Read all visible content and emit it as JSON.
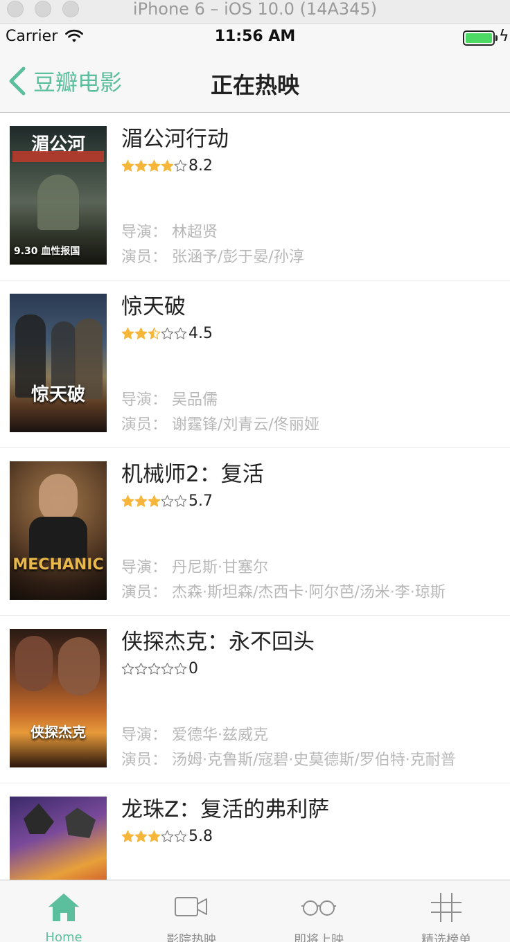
{
  "simulator": {
    "title": "iPhone 6 – iOS 10.0 (14A345)"
  },
  "status_bar": {
    "carrier": "Carrier",
    "time": "11:56 AM"
  },
  "navbar": {
    "back_label": "豆瓣电影",
    "title": "正在热映"
  },
  "colors": {
    "accent": "#5bbf9e",
    "star": "#f5b63a",
    "muted": "#b8b8b8"
  },
  "movies": [
    {
      "title": "湄公河行动",
      "stars": 4,
      "score": "8.2",
      "director": "导演：  林超贤",
      "actors": "演员：  张涵予/彭于晏/孙淳",
      "poster_text": "9.30 血性报国"
    },
    {
      "title": "惊天破",
      "stars": 2.5,
      "score": "4.5",
      "director": "导演：  吴品儒",
      "actors": "演员：  谢霆锋/刘青云/佟丽娅",
      "poster_text": "惊天破"
    },
    {
      "title": "机械师2：复活",
      "stars": 3,
      "score": "5.7",
      "director": "导演：  丹尼斯·甘塞尔",
      "actors": "演员：  杰森·斯坦森/杰西卡·阿尔芭/汤米·李·琼斯",
      "poster_text": "MECHANIC"
    },
    {
      "title": "侠探杰克：永不回头",
      "stars": 0,
      "score": "0",
      "director": "导演：  爱德华·兹威克",
      "actors": "演员：  汤姆·克鲁斯/寇碧·史莫德斯/罗伯特·克耐普",
      "poster_text": "侠探杰克"
    },
    {
      "title": "龙珠Z：复活的弗利萨",
      "stars": 3,
      "score": "5.8",
      "director": "",
      "actors": "",
      "poster_text": ""
    }
  ],
  "tabbar": {
    "tabs": [
      {
        "label": "Home",
        "icon": "home-icon",
        "active": true
      },
      {
        "label": "影院热映",
        "icon": "video-camera-icon",
        "active": false
      },
      {
        "label": "即将上映",
        "icon": "glasses-icon",
        "active": false
      },
      {
        "label": "精选榜单",
        "icon": "grid-hash-icon",
        "active": false
      }
    ]
  }
}
